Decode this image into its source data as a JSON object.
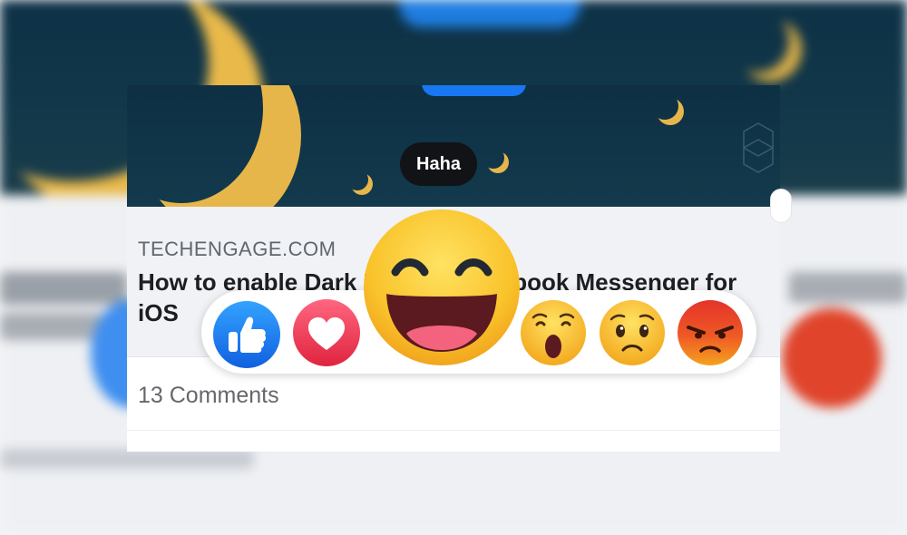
{
  "post": {
    "domain": "TECHENGAGE.COM",
    "title": "How to enable Dark Mode in Facebook Messenger for iOS",
    "comments": "13 Comments"
  },
  "tooltip": {
    "label": "Haha"
  },
  "reactions": [
    {
      "name": "Like",
      "icon": "thumbs-up-icon",
      "color": "#1877f2"
    },
    {
      "name": "Love",
      "icon": "heart-icon",
      "color": "#f33e58"
    },
    {
      "name": "Haha",
      "icon": "laughing-face-icon",
      "color": "#f7b125",
      "active": true
    },
    {
      "name": "Wow",
      "icon": "surprised-face-icon",
      "color": "#f7b125"
    },
    {
      "name": "Sad",
      "icon": "sad-face-icon",
      "color": "#f7b125"
    },
    {
      "name": "Angry",
      "icon": "angry-face-icon",
      "color": "#e9710f"
    }
  ],
  "colors": {
    "banner": "#0e2f44",
    "moon": "#e6b64b",
    "accent": "#1877f2"
  }
}
